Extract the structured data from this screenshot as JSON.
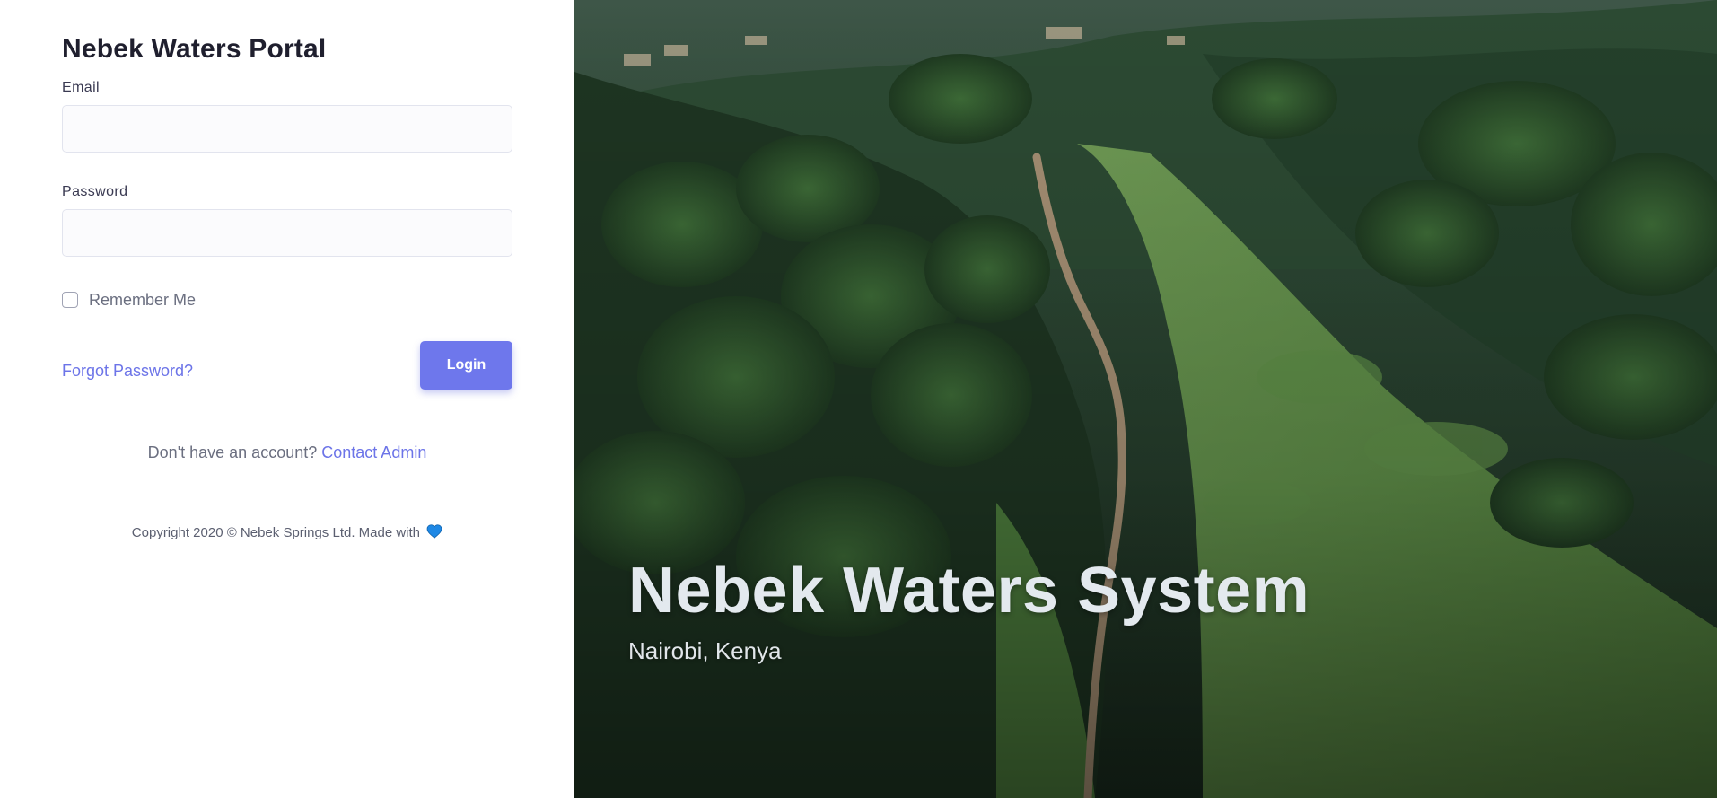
{
  "login": {
    "title": "Nebek Waters Portal",
    "email_label": "Email",
    "email_value": "",
    "password_label": "Password",
    "password_value": "",
    "remember_label": "Remember Me",
    "remember_checked": false,
    "forgot_link": "Forgot Password?",
    "login_button": "Login",
    "signup_prompt": "Don't have an account?",
    "contact_link": "Contact Admin",
    "copyright": "Copyright 2020 © Nebek Springs Ltd. Made with",
    "heart_icon": "blue-heart-icon"
  },
  "hero": {
    "title": "Nebek Waters System",
    "subtitle": "Nairobi, Kenya",
    "image": "aerial-forest-ridge-path-photo"
  },
  "colors": {
    "accent": "#6e77ec",
    "link": "#6c74e8",
    "heart": "#1e88e5"
  }
}
